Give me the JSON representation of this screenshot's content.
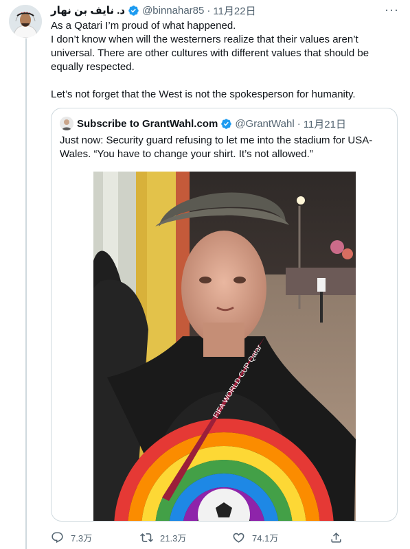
{
  "tweet": {
    "author_name": "د. نايف بن نهار",
    "handle": "@binnahar85",
    "separator": "·",
    "date": "11月22日",
    "more": "···",
    "lines": [
      "As a Qatari I’m proud of what happened.",
      "I don’t know when will the westerners realize that their values aren’t universal. There are other cultures with different values that should be equally respected."
    ],
    "closing": "Let’s not forget that the West is not the spokesperson for humanity."
  },
  "quote": {
    "author_name": "Subscribe to GrantWahl.com",
    "handle": "@GrantWahl",
    "separator": "·",
    "date": "11月21日",
    "text": "Just now: Security guard refusing to let me into the stadium for USA-Wales. “You have to change your shirt. It’s not allowed.”",
    "photo_text": "FIFA WORLD CUP Qatar"
  },
  "actions": {
    "replies": "7.3万",
    "retweets": "21.3万",
    "likes": "74.1万"
  },
  "colors": {
    "text": "#0f1419",
    "secondary": "#536471",
    "verified": "#1d9bf0",
    "border": "#cfd9de"
  },
  "icons": [
    "verified-badge-icon",
    "more-icon",
    "reply-icon",
    "retweet-icon",
    "like-icon",
    "share-icon"
  ]
}
